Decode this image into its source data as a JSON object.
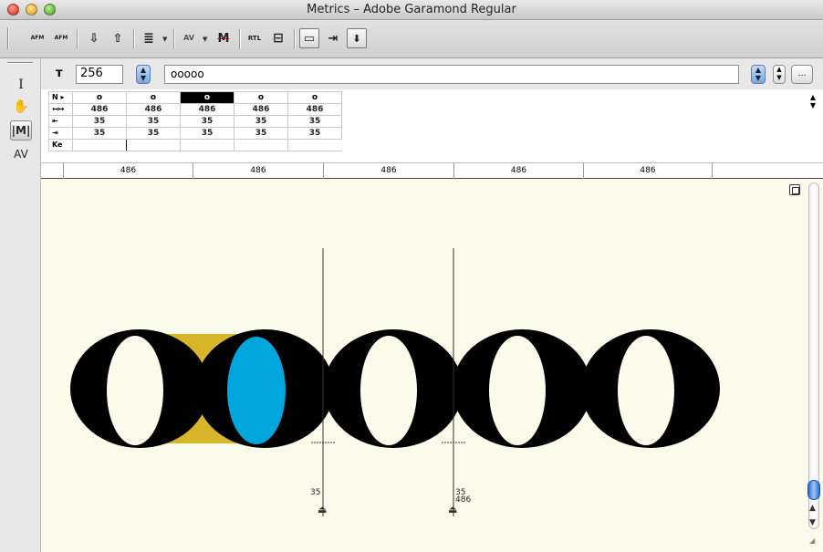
{
  "window": {
    "title": "Metrics – Adobe Garamond Regular"
  },
  "toolbar": {
    "buttons": [
      {
        "name": "open-afm-button",
        "icon": "afm-open-icon",
        "text": "AFM"
      },
      {
        "name": "save-afm-button",
        "icon": "afm-save-icon",
        "text": "AFM"
      },
      {
        "name": "import-button",
        "icon": "import-icon",
        "text": "⇩"
      },
      {
        "name": "export-button",
        "icon": "export-icon",
        "text": "⇧"
      },
      {
        "name": "kerning-pairs-button",
        "icon": "kerning-list-icon",
        "text": "≣"
      },
      {
        "name": "auto-kern-button",
        "icon": "autokern-icon",
        "text": "AV"
      },
      {
        "name": "metrics-button",
        "icon": "metrics-m-icon",
        "text": "M"
      },
      {
        "name": "rtl-button",
        "icon": "rtl-icon",
        "text": "RTL"
      },
      {
        "name": "center-button",
        "icon": "center-icon",
        "text": "⊟"
      },
      {
        "name": "show-metrics-button",
        "icon": "show-metrics-icon",
        "text": "▭"
      },
      {
        "name": "show-kerning-button",
        "icon": "show-kerning-icon",
        "text": "⇥"
      },
      {
        "name": "show-table-button",
        "icon": "show-table-icon",
        "text": "⬇"
      }
    ]
  },
  "palette": {
    "tools": [
      {
        "name": "text-tool",
        "icon": "text-cursor-icon",
        "glyph": "I"
      },
      {
        "name": "hand-tool",
        "icon": "hand-icon",
        "glyph": "✋"
      },
      {
        "name": "metrics-tool",
        "icon": "metrics-tool-icon",
        "glyph": "|M|"
      },
      {
        "name": "kerning-tool",
        "icon": "kerning-tool-icon",
        "glyph": "AV"
      }
    ]
  },
  "controls": {
    "size_icon": "т",
    "size_value": "256",
    "text_value": "ooooo"
  },
  "metrics_table": {
    "labels": {
      "name": "N ▸",
      "width": "↤↦",
      "lsb": "⇤",
      "rsb": "⇥",
      "kern": "Ke"
    },
    "names": [
      "o",
      "o",
      "o",
      "o",
      "o"
    ],
    "widths": [
      "486",
      "486",
      "486",
      "486",
      "486"
    ],
    "lsb": [
      "35",
      "35",
      "35",
      "35",
      "35"
    ],
    "rsb": [
      "35",
      "35",
      "35",
      "35",
      "35"
    ],
    "selected_index": 2
  },
  "ruler": {
    "values": [
      "486",
      "486",
      "486",
      "486",
      "486"
    ]
  },
  "canvas": {
    "glyph": "o",
    "selected_glyph_fill": "#00a6dc",
    "kern_highlight": "#d8b62a",
    "background": "#fbfbec",
    "left_sidebearing_label": "35",
    "right_sidebearing_label": "35",
    "advance_label": "486"
  }
}
